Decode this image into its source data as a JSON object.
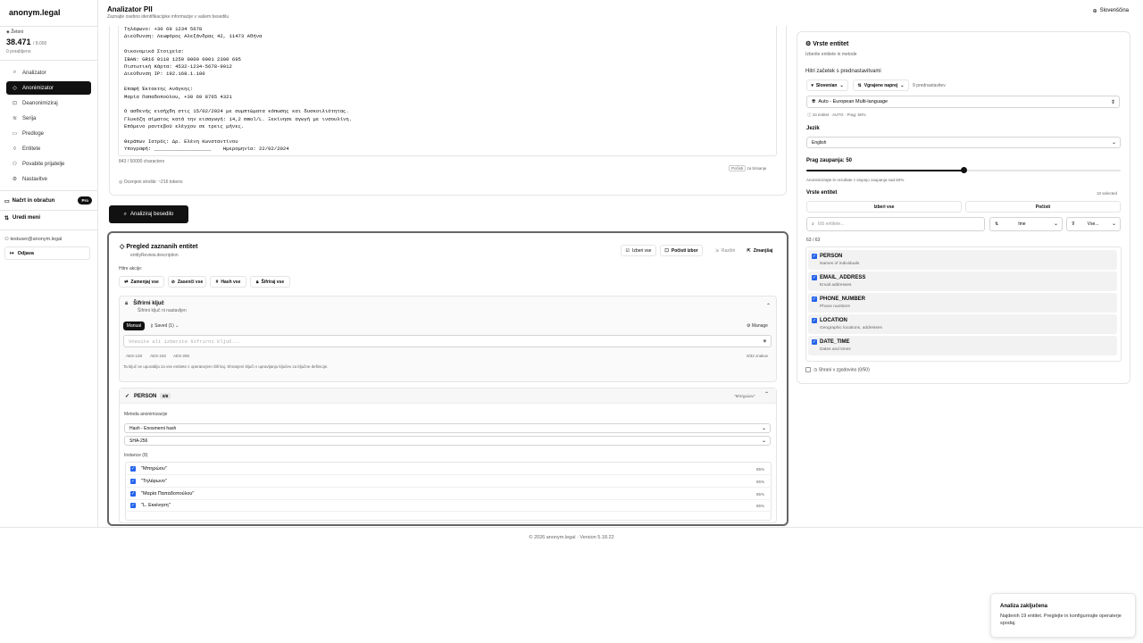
{
  "app": {
    "brand": "anonym.legal"
  },
  "tokens": {
    "label": "Žetoni",
    "value": "38.471",
    "limit": "/ 8.000",
    "used": "0 porabljeno"
  },
  "nav": [
    {
      "label": "Analizator",
      "icon": "search-icon"
    },
    {
      "label": "Anonimizator",
      "icon": "shield-icon"
    },
    {
      "label": "Deanonimiziraj",
      "icon": "unlock-icon"
    },
    {
      "label": "Serija",
      "icon": "layers-icon"
    },
    {
      "label": "Predloge",
      "icon": "file-icon"
    },
    {
      "label": "Entitete",
      "icon": "tag-icon"
    },
    {
      "label": "Povabite prijatelje",
      "icon": "users-icon"
    },
    {
      "label": "Nastavitve",
      "icon": "gear-icon"
    }
  ],
  "sidebar": {
    "draft": "Načrt in obračun",
    "pro": "Pro",
    "edit_menu": "Uredi meni",
    "user": "testuser@anonym.legal",
    "logout": "Odjava"
  },
  "header": {
    "title": "Analizator PII",
    "subtitle": "Zaznajte osebno identifikacijske informacije v vašem besedilu",
    "language": "Slovenščina"
  },
  "text_lines": [
    "Τηλέφωνο: +30 69 1234 5678",
    "Διεύθυνση: Λεωφόρος Αλεξάνδρας 42, 11473 Αθήνα",
    "",
    "Οικονομικά Στοιχεία:",
    "IBAN: GR16 0110 1250 0000 0001 2300 695",
    "Πιστωτική Κάρτα: 4532-1234-5678-9012",
    "Διεύθυνση IP: 192.168.1.100",
    "",
    "Επαφή Έκτακτης Ανάγκης:",
    "Μαρία Παπαδοπούλου, +30 69 8765 4321",
    "",
    "Ο ασθενής εισήχθη στις 15/02/2024 με συμπτώματα κόπωσης και δυσκοιλιότητας.",
    "Γλυκόζη αίματος κατά την εισαγωγή: 14,2 mmol/L. Ξεκίνησε αγωγή με ινσουλίνη.",
    "Επόμενο ραντεβού ελέγχου σε τρεις μήνες.",
    "",
    "Θεράπων Ιατρός: Δρ. Ελένη Κωνσταντίνου",
    "Υπογραφή: ___________________    Ημερομηνία: 22/02/2024"
  ],
  "editor": {
    "char_count": "843 / 50000 characters",
    "clear": "Počisti",
    "clear_suffix": "za brisanje",
    "estimate": "Ocenjeni stroški: ~216 tokens"
  },
  "analyze_button": "Analiziraj besedilo",
  "review": {
    "title": "Pregled zaznanih entitet",
    "subtitle": "entityReview.description",
    "select_all": "Izberi vse",
    "clear_sel": "Počisti izbor",
    "expand": "Razširi",
    "collapse": "Zmanjšaj",
    "quick_actions": "Hitre akcije:",
    "actions": [
      "Zamenjaj vse",
      "Zasenči vse",
      "Hash vse",
      "Šifriraj vse"
    ],
    "key_title": "Šifrirni ključ",
    "key_sub": "Šifrirni ključ ni nastavljen",
    "manual": "Manual",
    "saved": "Saved (1)",
    "manage": "Manage",
    "key_placeholder": "Vnesite ali izberite šifrirni ključ...",
    "algos": [
      "AES-128",
      "AES-192",
      "AES-256"
    ],
    "key_count": "0/32 znakov",
    "key_note": "Ta ključ se uporablja za vse entitete z operatorjem Šifriraj. Shranjeni ključi v upravljanju ključev za ključne definicije.",
    "entity_name": "PERSON",
    "entity_count": "8/8",
    "entity_sample": "\"Μπηρώου\"",
    "method_label": "Metoda anonimizacije",
    "method": "Hash - Enosmerni hash",
    "algo": "SHA-256",
    "instances_label": "Instance (8)",
    "instances": [
      {
        "text": "\"Μπηρώου\"",
        "score": "85%"
      },
      {
        "text": "\"Τηλέφωνο\"",
        "score": "85%"
      },
      {
        "text": "\"Μαρία Παπαδοπούλου\"",
        "score": "85%"
      },
      {
        "text": "\"L. Εκκίνηση\"",
        "score": "85%"
      }
    ]
  },
  "entity_panel": {
    "title": "Vrste entitet",
    "subtitle": "Izberite entitete in metode",
    "quick_start": "Hitri začetek s prednastavitvami",
    "preset_lang": "Slovenian",
    "preset_builtin": "Vgrajene naprej",
    "preset_count": "9 prednastavitev",
    "preset_selected": "Auto - European Multi-language",
    "preset_meta": "10 entitet · AUTO · Prag: 50%",
    "lang_label": "Jezik",
    "lang_value": "English",
    "threshold_label": "Prag zaupanja: 50",
    "threshold_value": 0.5,
    "threshold_note": "Anonimizirajte le rezultate z stopnjo zaupanja nad 50%",
    "types_label": "Vrste entitet",
    "types_selected": "10 selected",
    "select_all": "Izberi vse",
    "clear": "Počisti",
    "search_placeholder": "Išči entitete...",
    "sort": "Ime",
    "filter": "Vse...",
    "count": "63 / 63",
    "entities": [
      {
        "name": "PERSON",
        "desc": "Names of individuals"
      },
      {
        "name": "EMAIL_ADDRESS",
        "desc": "Email addresses"
      },
      {
        "name": "PHONE_NUMBER",
        "desc": "Phone numbers"
      },
      {
        "name": "LOCATION",
        "desc": "Geographic locations, addresses"
      },
      {
        "name": "DATE_TIME",
        "desc": "Dates and times"
      }
    ],
    "history": "Shrani v zgodovino (0/50)"
  },
  "footer": "© 2026 anonym.legal · Version 5.18.22",
  "toast": {
    "title": "Analiza zaključena",
    "body": "Najdenih 19 entitet. Preglejte in konfigurirajte operaterje spodaj."
  }
}
